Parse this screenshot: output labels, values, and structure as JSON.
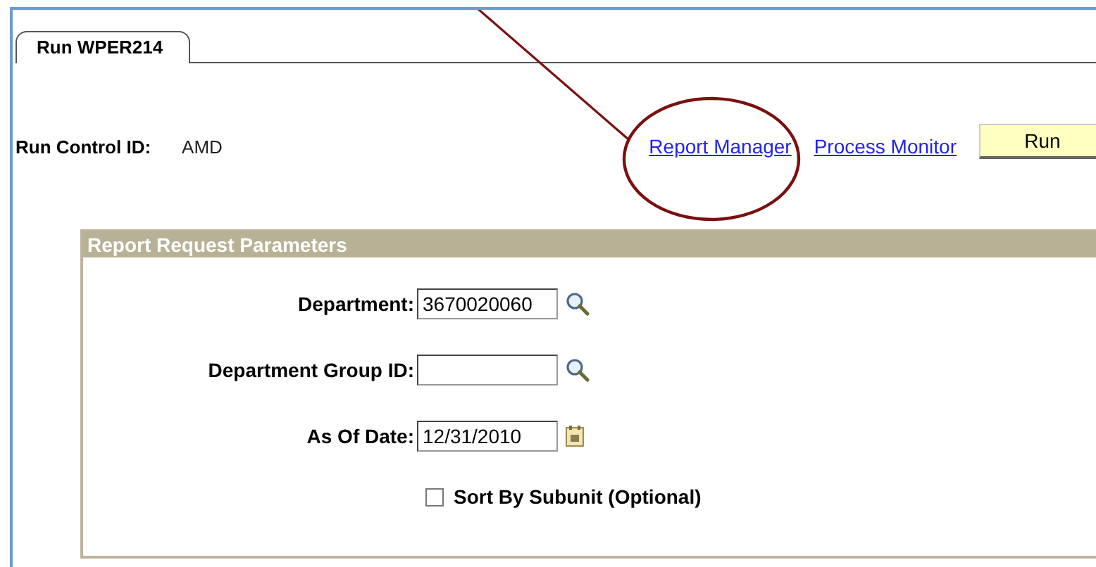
{
  "tabs": [
    {
      "label": "Run WPER214",
      "selected": true
    }
  ],
  "run_control": {
    "label": "Run Control ID:",
    "value": "AMD"
  },
  "links": [
    "Report Manager",
    "Process Monitor"
  ],
  "run_button": "Run",
  "panel": {
    "title": "Report Request Parameters",
    "fields": [
      {
        "kind": "lookup",
        "label": "Department:",
        "value": "3670020060"
      },
      {
        "kind": "lookup",
        "label": "Department Group ID:"
      },
      {
        "kind": "date",
        "label": "As Of Date:",
        "value": "12/31/2010"
      }
    ],
    "checkbox": {
      "label": "Sort By Subunit (Optional)",
      "checked": false
    }
  }
}
